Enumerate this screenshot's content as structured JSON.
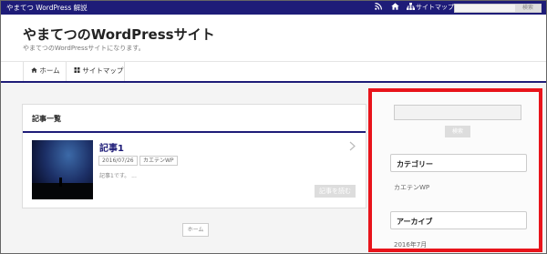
{
  "topbar": {
    "title": "やまてつ WordPress 解説",
    "rss_icon": "rss-icon",
    "home_icon": "home-icon",
    "sitemap_icon": "sitemap-icon",
    "sitemap_label": "サイトマップ",
    "search_placeholder": "",
    "search_button": "検索"
  },
  "header": {
    "site_title": "やまてつのWordPressサイト",
    "site_description": "やまてつのWordPressサイトになります。"
  },
  "nav": {
    "items": [
      {
        "icon": "home-icon",
        "label": "ホーム"
      },
      {
        "icon": "grid-icon",
        "label": "サイトマップ"
      }
    ]
  },
  "main": {
    "heading": "記事一覧",
    "articles": [
      {
        "title": "記事1",
        "date": "2016/07/26",
        "category": "カエテンWP",
        "excerpt": "記事1です。 ...",
        "read_more": "記事を読む"
      }
    ],
    "home_button": "ホーム"
  },
  "sidebar": {
    "search_placeholder": "",
    "search_button": "検索",
    "category_heading": "カテゴリー",
    "categories": [
      "カエテンWP"
    ],
    "archive_heading": "アーカイブ",
    "archives": [
      "2016年7月"
    ]
  },
  "colors": {
    "brand_navy": "#1e1c78",
    "highlight_red": "#e8141b"
  }
}
